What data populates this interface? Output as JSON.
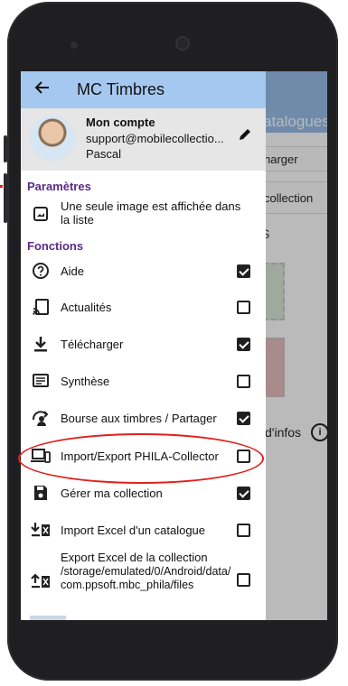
{
  "background_app": {
    "title_partial": "atalogues",
    "button1_partial": "harger",
    "button2_partial": "collection",
    "infos_partial": "d'infos",
    "letter_partial": "S"
  },
  "drawer": {
    "title": "MC Timbres",
    "account": {
      "title": "Mon compte",
      "email": "support@mobilecollectio...",
      "name": "Pascal"
    },
    "sections": {
      "parametres": "Paramètres",
      "fonctions": "Fonctions"
    },
    "param_item": {
      "label": "Une seule image est affichée dans la liste"
    },
    "items": [
      {
        "label": "Aide",
        "checked": true,
        "icon": "help-circle-icon"
      },
      {
        "label": "Actualités",
        "checked": false,
        "icon": "cast-icon"
      },
      {
        "label": "Télécharger",
        "checked": true,
        "icon": "download-icon"
      },
      {
        "label": "Synthèse",
        "checked": false,
        "icon": "summary-icon"
      },
      {
        "label": "Bourse aux timbres / Partager",
        "checked": true,
        "icon": "share-exchange-icon"
      },
      {
        "label": "Import/Export PHILA-Collector",
        "checked": false,
        "icon": "devices-icon"
      },
      {
        "label": "Gérer ma collection",
        "checked": true,
        "icon": "save-icon"
      },
      {
        "label": "Import Excel d'un catalogue",
        "checked": false,
        "icon": "excel-import-icon"
      },
      {
        "label": "Export Excel de la collection",
        "path": "/storage/emulated/0/Android/data/com.ppsoft.mbc_phila/files",
        "checked": false,
        "icon": "excel-export-icon"
      }
    ]
  },
  "colors": {
    "header": "#a5c8f0",
    "section": "#5b2a86",
    "highlight": "#e2201c"
  }
}
